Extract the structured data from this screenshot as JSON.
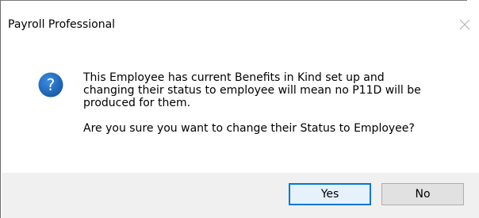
{
  "window": {
    "title": "Payroll Professional",
    "close_icon": "close-icon"
  },
  "message": {
    "icon": "question-icon",
    "line1": "This Employee has current Benefits in Kind set up and",
    "line2": "changing their status to employee will mean no P11D will be",
    "line3": "produced for them.",
    "line4": "Are you sure you want to change their Status to Employee?"
  },
  "buttons": {
    "yes_label": "Yes",
    "no_label": "No"
  },
  "colors": {
    "icon_blue": "#1f6fc5",
    "focus_border": "#0078d7",
    "footer_bg": "#f0f0f0"
  }
}
